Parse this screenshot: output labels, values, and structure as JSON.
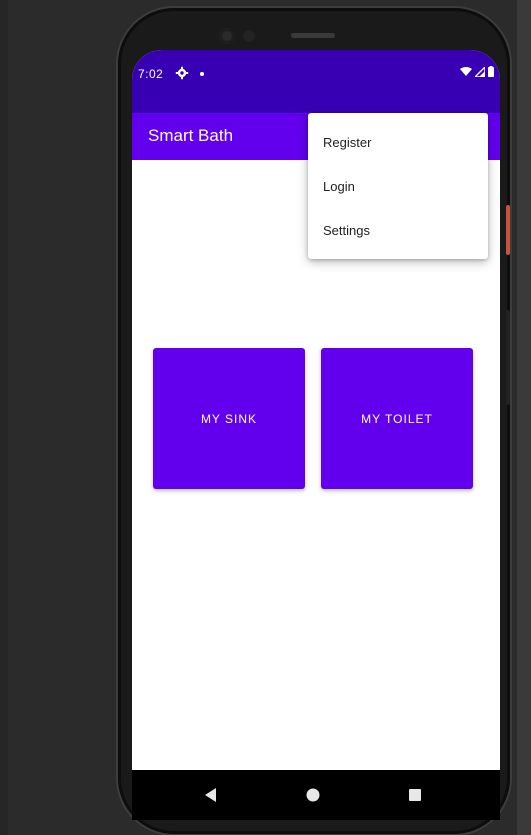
{
  "status_bar": {
    "time": "7:02",
    "color": "#3700b3"
  },
  "app_bar": {
    "title": "Smart Bath",
    "color": "#6200ee"
  },
  "overflow_menu": {
    "items": [
      {
        "label": "Register"
      },
      {
        "label": "Login"
      },
      {
        "label": "Settings"
      }
    ]
  },
  "main": {
    "buttons": [
      {
        "label": "MY SINK"
      },
      {
        "label": "MY TOILET"
      }
    ],
    "button_color": "#6200ee"
  },
  "nav_bar": {
    "icons": [
      "back-icon",
      "home-icon",
      "recents-icon"
    ]
  }
}
